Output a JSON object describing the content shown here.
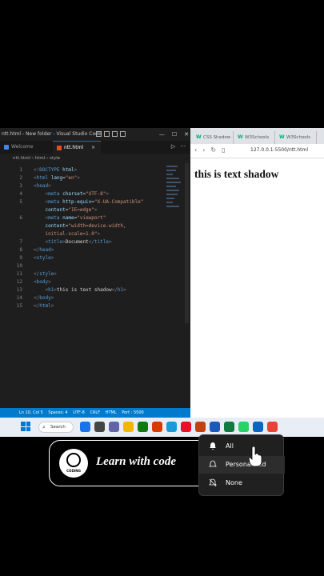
{
  "vscode": {
    "title": "ntt.html - New folder - Visual Studio Code",
    "tabs": [
      {
        "label": "Welcome"
      },
      {
        "label": "ntt.html",
        "close": "×"
      }
    ],
    "breadcrumb": "ntt.html  ›  html  ›  style",
    "lines": [
      {
        "n": "1",
        "html": "<span class='pu'>&lt;!</span><span class='tg'>DOCTYPE</span> <span class='at'>html</span><span class='pu'>&gt;</span>"
      },
      {
        "n": "2",
        "html": "<span class='pu'>&lt;</span><span class='tg'>html</span> <span class='at'>lang</span>=<span class='st'>\"en\"</span><span class='pu'>&gt;</span>"
      },
      {
        "n": "3",
        "html": "<span class='pu'>&lt;</span><span class='tg'>head</span><span class='pu'>&gt;</span>"
      },
      {
        "n": "4",
        "html": "    <span class='pu'>&lt;</span><span class='tg'>meta</span> <span class='at'>charset</span>=<span class='st'>\"UTF-8\"</span><span class='pu'>&gt;</span>"
      },
      {
        "n": "5",
        "html": "    <span class='pu'>&lt;</span><span class='tg'>meta</span> <span class='at'>http-equiv</span>=<span class='st'>\"X-UA-Compatible\"</span>"
      },
      {
        "n": "",
        "html": "    <span class='at'>content</span>=<span class='st'>\"IE=edge\"</span><span class='pu'>&gt;</span>"
      },
      {
        "n": "6",
        "html": "    <span class='pu'>&lt;</span><span class='tg'>meta</span> <span class='at'>name</span>=<span class='st'>\"viewport\"</span>"
      },
      {
        "n": "",
        "html": "    <span class='at'>content</span>=<span class='st'>\"width=device-width,</span>"
      },
      {
        "n": "",
        "html": "    <span class='st'>initial-scale=1.0\"</span><span class='pu'>&gt;</span>"
      },
      {
        "n": "7",
        "html": "    <span class='pu'>&lt;</span><span class='tg'>title</span><span class='pu'>&gt;</span>Document<span class='pu'>&lt;/</span><span class='tg'>title</span><span class='pu'>&gt;</span>"
      },
      {
        "n": "8",
        "html": "<span class='pu'>&lt;/</span><span class='tg'>head</span><span class='pu'>&gt;</span>"
      },
      {
        "n": "9",
        "html": "<span class='pu'>&lt;</span><span class='tg'>style</span><span class='pu'>&gt;</span>"
      },
      {
        "n": "10",
        "html": ""
      },
      {
        "n": "11",
        "html": "<span class='pu'>&lt;/</span><span class='tg'>style</span><span class='pu'>&gt;</span>"
      },
      {
        "n": "12",
        "html": "<span class='pu'>&lt;</span><span class='tg'>body</span><span class='pu'>&gt;</span>"
      },
      {
        "n": "13",
        "html": "    <span class='pu'>&lt;</span><span class='tg'>h1</span><span class='pu'>&gt;</span>this is text shadow<span class='pu'>&lt;/</span><span class='tg'>h1</span><span class='pu'>&gt;</span>"
      },
      {
        "n": "14",
        "html": "<span class='pu'>&lt;/</span><span class='tg'>body</span><span class='pu'>&gt;</span>"
      },
      {
        "n": "15",
        "html": "<span class='pu'>&lt;/</span><span class='tg'>html</span><span class='pu'>&gt;</span>"
      }
    ],
    "status": [
      "Ln 10, Col 5",
      "Spaces: 4",
      "UTF-8",
      "CRLF",
      "HTML",
      "Port : 5500"
    ]
  },
  "browser": {
    "tabs": [
      "CSS Shadow",
      "W3Schools",
      "W3Schools"
    ],
    "url": "127.0.0.1:5500/ntt.html",
    "heading": "this is text shadow"
  },
  "taskbar": {
    "search_label": "Search",
    "icon_colors": [
      "#1a73e8",
      "#444",
      "#6264a7",
      "#f2b600",
      "#0f7b0f",
      "#d83b01",
      "#1a9bd7",
      "#e81123",
      "#c2410c",
      "#185abd",
      "#107c41",
      "#25d366",
      "#0a66c2",
      "#ea4335"
    ]
  },
  "banner": {
    "logo_text": "CODING",
    "text": "Learn with code"
  },
  "popup": {
    "items": [
      "All",
      "Personalized",
      "None"
    ]
  }
}
